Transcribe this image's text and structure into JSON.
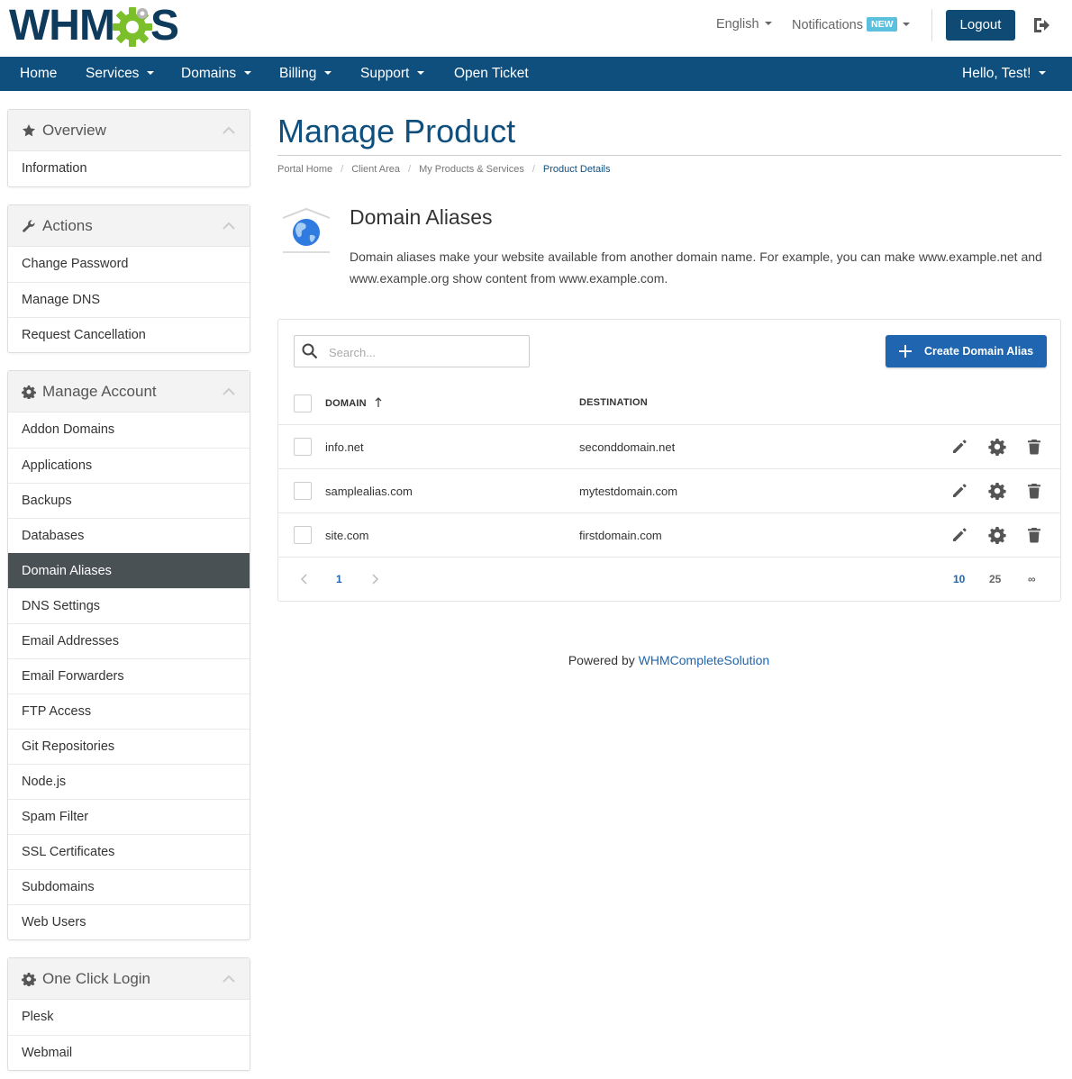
{
  "header": {
    "logo_text_a": "WHM",
    "logo_text_b": "S",
    "language": "English",
    "notifications": "Notifications",
    "notifications_badge": "NEW",
    "logout": "Logout"
  },
  "nav": {
    "home": "Home",
    "services": "Services",
    "domains": "Domains",
    "billing": "Billing",
    "support": "Support",
    "open_ticket": "Open Ticket",
    "user": "Hello, Test!"
  },
  "sidebar": {
    "overview": {
      "title": "Overview",
      "items": [
        "Information"
      ]
    },
    "actions": {
      "title": "Actions",
      "items": [
        "Change Password",
        "Manage DNS",
        "Request Cancellation"
      ]
    },
    "manage_account": {
      "title": "Manage Account",
      "items": [
        "Addon Domains",
        "Applications",
        "Backups",
        "Databases",
        "Domain Aliases",
        "DNS Settings",
        "Email Addresses",
        "Email Forwarders",
        "FTP Access",
        "Git Repositories",
        "Node.js",
        "Spam Filter",
        "SSL Certificates",
        "Subdomains",
        "Web Users"
      ],
      "active": "Domain Aliases"
    },
    "one_click_login": {
      "title": "One Click Login",
      "items": [
        "Plesk",
        "Webmail"
      ]
    }
  },
  "main": {
    "title": "Manage Product",
    "breadcrumb": [
      "Portal Home",
      "Client Area",
      "My Products & Services",
      "Product Details"
    ],
    "module_title": "Domain Aliases",
    "module_desc": "Domain aliases make your website available from another domain name. For example, you can make www.example.net and www.example.org show content from www.example.com.",
    "search_placeholder": "Search...",
    "create_button": "Create Domain Alias",
    "columns": {
      "domain": "DOMAIN",
      "destination": "DESTINATION"
    },
    "rows": [
      {
        "domain": "info.net",
        "destination": "seconddomain.net"
      },
      {
        "domain": "samplealias.com",
        "destination": "mytestdomain.com"
      },
      {
        "domain": "site.com",
        "destination": "firstdomain.com"
      }
    ],
    "pagination": {
      "current_page": "1",
      "sizes": [
        "10",
        "25",
        "∞"
      ],
      "active_size": "10"
    }
  },
  "footer": {
    "prefix": "Powered by",
    "link": "WHMCompleteSolution"
  },
  "colors": {
    "brand": "#0e4f7e",
    "accent": "#1f65b0",
    "active_item": "#4a5155",
    "badge": "#5bc0de",
    "logo_green": "#7bbf2a"
  },
  "icons": [
    "star-icon",
    "wrench-icon",
    "gear-icon",
    "chevron-up-icon",
    "globe-icon",
    "search-icon",
    "plus-icon",
    "pencil-icon",
    "delete-icon",
    "exit-icon",
    "sort-up-icon",
    "chevron-left-icon",
    "chevron-right-icon"
  ]
}
